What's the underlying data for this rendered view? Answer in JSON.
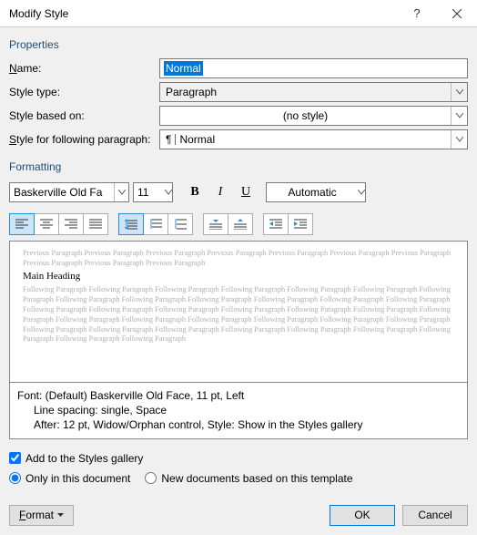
{
  "title": "Modify Style",
  "sections": {
    "properties": "Properties",
    "formatting": "Formatting"
  },
  "properties": {
    "name_label": "Name:",
    "name_value": "Normal",
    "type_label": "Style type:",
    "type_value": "Paragraph",
    "based_label": "Style based on:",
    "based_value": "(no style)",
    "following_label": "Style for following paragraph:",
    "following_value": "Normal"
  },
  "formatting": {
    "font": "Baskerville Old Fa",
    "size": "11",
    "bold": "B",
    "italic": "I",
    "underline": "U",
    "color": "Automatic"
  },
  "preview": {
    "prev": "Previous Paragraph Previous Paragraph Previous Paragraph Previous Paragraph Previous Paragraph Previous Paragraph Previous Paragraph Previous Paragraph Previous Paragraph Previous Paragraph",
    "heading": "Main Heading",
    "follow": "Following Paragraph Following Paragraph Following Paragraph Following Paragraph Following Paragraph Following Paragraph Following Paragraph Following Paragraph Following Paragraph Following Paragraph Following Paragraph Following Paragraph Following Paragraph Following Paragraph Following Paragraph Following Paragraph Following Paragraph Following Paragraph Following Paragraph Following Paragraph Following Paragraph Following Paragraph Following Paragraph Following Paragraph Following Paragraph Following Paragraph Following Paragraph Following Paragraph Following Paragraph Following Paragraph Following Paragraph Following Paragraph Following Paragraph Following Paragraph Following Paragraph"
  },
  "description": {
    "l1": "Font: (Default) Baskerville Old Face, 11 pt, Left",
    "l2": "Line spacing:  single, Space",
    "l3": "After:  12 pt, Widow/Orphan control, Style: Show in the Styles gallery"
  },
  "options": {
    "add_gallery": "Add to the Styles gallery",
    "only_doc": "Only in this document",
    "new_docs": "New documents based on this template"
  },
  "buttons": {
    "format": "Format",
    "ok": "OK",
    "cancel": "Cancel"
  }
}
